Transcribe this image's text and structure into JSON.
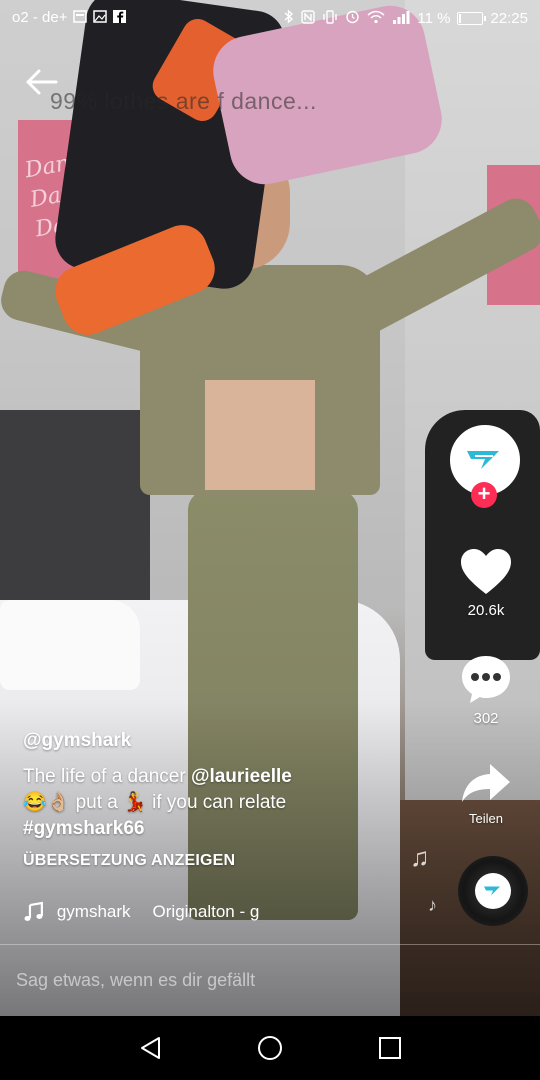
{
  "status_bar": {
    "carrier": "o2 - de+",
    "battery_percent": "11 %",
    "battery_level": 0.11,
    "time": "22:25",
    "icons_left": [
      "sim-card-icon",
      "image-icon",
      "facebook-icon"
    ],
    "icons_right": [
      "bluetooth-icon",
      "nfc-icon",
      "vibrate-icon",
      "alarm-icon",
      "wifi-icon",
      "signal-icon",
      "battery-icon"
    ]
  },
  "video": {
    "overlay_caption": "99%        lothes are f    dance..."
  },
  "actions": {
    "like_count": "20.6k",
    "comment_count": "302",
    "share_label": "Teilen",
    "accent_color": "#ff2c55",
    "brand_color": "#2db8d8"
  },
  "post": {
    "username": "@gymshark",
    "desc_line1_prefix": "The life of a dancer ",
    "desc_line1_mention": "@laurieelle",
    "desc_line2_text1": " put a ",
    "desc_line2_text2": " if you can relate",
    "desc_emoji_1": "😂👌🏼",
    "desc_emoji_2": "💃",
    "hashtag": "#gymshark66",
    "translate_label": "ÜBERSETZUNG ANZEIGEN",
    "sound_author": "gymshark",
    "sound_name": "Originalton - g"
  },
  "comment": {
    "placeholder": "Sag etwas, wenn es dir gefällt"
  }
}
